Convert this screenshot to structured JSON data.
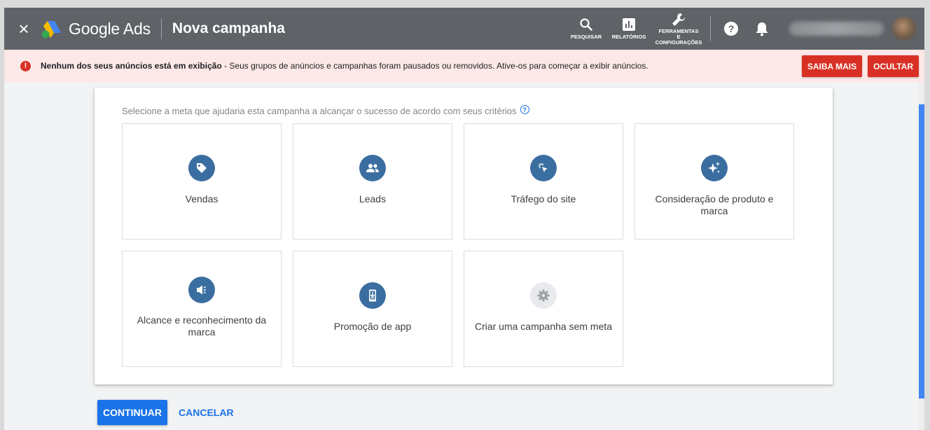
{
  "header": {
    "close_label": "×",
    "brand": "Google Ads",
    "page_title": "Nova campanha",
    "actions": {
      "search": "PESQUISAR",
      "reports": "RELATÓRIOS",
      "tools_line1": "FERRAMENTAS",
      "tools_line2": "E",
      "tools_line3": "CONFIGURAÇÕES"
    }
  },
  "alert": {
    "strong": "Nenhum dos seus anúncios está em exibição",
    "text": " - Seus grupos de anúncios e campanhas foram pausados ou removidos. Ative-os para começar a exibir anúncios.",
    "learn_more": "SAIBA MAIS",
    "hide": "OCULTAR"
  },
  "goals": {
    "prompt": "Selecione a meta que ajudaria esta campanha a alcançar o sucesso de acordo com seus critérios",
    "help_symbol": "?",
    "items": [
      {
        "label": "Vendas",
        "icon": "tag-icon"
      },
      {
        "label": "Leads",
        "icon": "people-icon"
      },
      {
        "label": "Tráfego do site",
        "icon": "cursor-click-icon"
      },
      {
        "label": "Consideração de produto e marca",
        "icon": "sparkle-icon"
      },
      {
        "label": "Alcance e reconhecimento da marca",
        "icon": "megaphone-icon"
      },
      {
        "label": "Promoção de app",
        "icon": "phone-download-icon"
      },
      {
        "label": "Criar uma campanha sem meta",
        "icon": "gear-icon"
      }
    ]
  },
  "footer": {
    "continue": "CONTINUAR",
    "cancel": "CANCELAR"
  },
  "colors": {
    "topbar": "#5f6368",
    "alert_bg": "#fce8e6",
    "alert_red": "#d93025",
    "primary_blue": "#1a73e8",
    "goal_icon_blue": "#3b6ea0"
  }
}
